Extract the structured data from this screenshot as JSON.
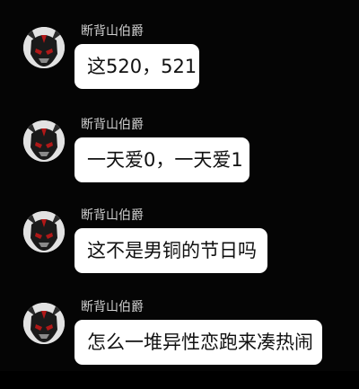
{
  "conversation": {
    "messages": [
      {
        "sender": "断背山伯爵",
        "avatar_icon": "demon-mask-avatar-icon",
        "text": "这520，521"
      },
      {
        "sender": "断背山伯爵",
        "avatar_icon": "demon-mask-avatar-icon",
        "text": "一天爱0，一天爱1"
      },
      {
        "sender": "断背山伯爵",
        "avatar_icon": "demon-mask-avatar-icon",
        "text": "这不是男铜的节日吗"
      },
      {
        "sender": "断背山伯爵",
        "avatar_icon": "demon-mask-avatar-icon",
        "text": "怎么一堆异性恋跑来凑热闹"
      }
    ]
  },
  "colors": {
    "background": "#050505",
    "bubble": "#ffffff",
    "bubble_text": "#111111",
    "sender_name": "#cfcfcf",
    "avatar_accent": "#b01818"
  }
}
